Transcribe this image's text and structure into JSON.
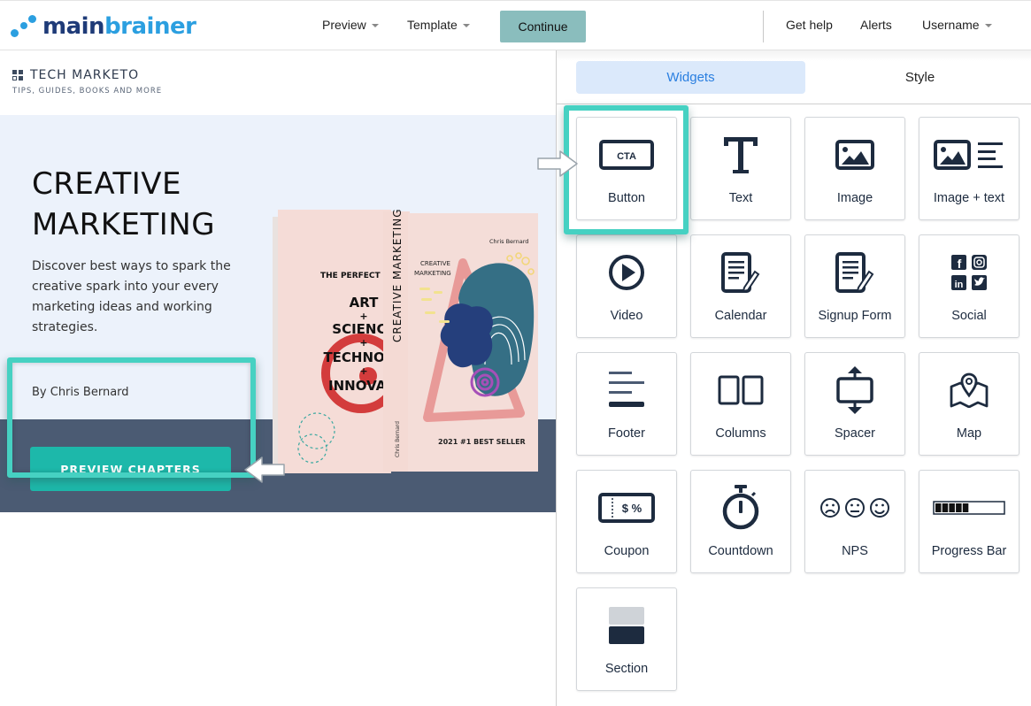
{
  "header": {
    "logo": {
      "part1": "main",
      "part2": "brainer"
    },
    "nav": [
      {
        "label": "Preview",
        "has_dropdown": true
      },
      {
        "label": "Template",
        "has_dropdown": true
      }
    ],
    "continue_label": "Continue",
    "right_nav": [
      {
        "label": "Get help"
      },
      {
        "label": "Alerts"
      },
      {
        "label": "Username",
        "has_dropdown": true
      }
    ]
  },
  "canvas": {
    "brand_title": "TECH MARKETO",
    "brand_subtitle": "TIPS, GUIDES, BOOKS AND MORE",
    "hero_title_line1": "CREATIVE",
    "hero_title_line2": "MARKETING",
    "hero_description": "Discover best ways to spark the creative spark into your every marketing ideas and working strategies.",
    "hero_author": "By Chris Bernard",
    "cta_label": "PREVIEW CHAPTERS",
    "book": {
      "back_heading": "THE PERFECT BLE",
      "back_lines": [
        "ART",
        "+",
        "SCIENCE",
        "+",
        "TECHNOLO",
        "+",
        "INNOVATI"
      ],
      "spine_title": "CREATIVE MARKETING",
      "spine_author": "Chris Bernard",
      "front_author": "Chris Bernard",
      "front_title_line1": "CREATIVE",
      "front_title_line2": "MARKETING",
      "front_badge": "2021 #1 BEST SELLER"
    }
  },
  "panel": {
    "tabs": [
      {
        "label": "Widgets",
        "active": true
      },
      {
        "label": "Style",
        "active": false
      }
    ],
    "widgets": [
      {
        "label": "Button",
        "icon": "cta-button-icon",
        "icon_text": "CTA",
        "highlighted": true
      },
      {
        "label": "Text",
        "icon": "text-icon"
      },
      {
        "label": "Image",
        "icon": "image-icon"
      },
      {
        "label": "Image + text",
        "icon": "image-text-icon"
      },
      {
        "label": "Video",
        "icon": "play-icon"
      },
      {
        "label": "Calendar",
        "icon": "calendar-icon"
      },
      {
        "label": "Signup Form",
        "icon": "signup-form-icon"
      },
      {
        "label": "Social",
        "icon": "social-icon"
      },
      {
        "label": "Footer",
        "icon": "footer-icon"
      },
      {
        "label": "Columns",
        "icon": "columns-icon"
      },
      {
        "label": "Spacer",
        "icon": "spacer-icon"
      },
      {
        "label": "Map",
        "icon": "map-icon"
      },
      {
        "label": "Coupon",
        "icon": "coupon-icon",
        "icon_text": "$ %"
      },
      {
        "label": "Countdown",
        "icon": "stopwatch-icon"
      },
      {
        "label": "NPS",
        "icon": "nps-icon"
      },
      {
        "label": "Progress Bar",
        "icon": "progress-bar-icon",
        "icon_progress": 0.5
      },
      {
        "label": "Section",
        "icon": "section-icon"
      }
    ]
  },
  "colors": {
    "accent_teal": "#1db8aa",
    "highlight": "#46d1c2",
    "continue_bg": "#8abdbd",
    "tab_active_bg": "#dbe9fb",
    "tab_active_text": "#2a7fe0",
    "icon_dark": "#1d2b3f",
    "hero_bg": "#ecf2fb",
    "hero_dark_band": "#4b5b73",
    "logo_dark": "#1f3b78",
    "logo_light": "#2b9fe0"
  }
}
